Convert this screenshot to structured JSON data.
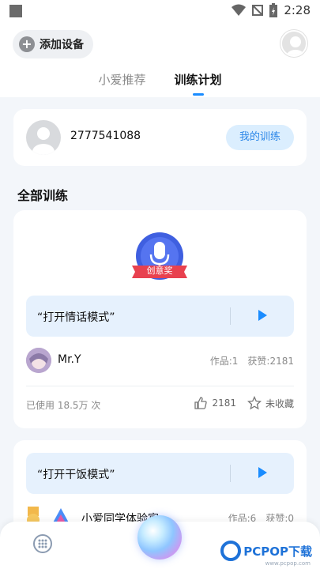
{
  "status_bar": {
    "time": "2:28",
    "icons": [
      "wifi-icon",
      "no-signal-icon",
      "battery-icon"
    ]
  },
  "header": {
    "add_device_label": "添加设备",
    "tabs": [
      {
        "label": "小爱推荐",
        "active": false
      },
      {
        "label": "训练计划",
        "active": true
      }
    ]
  },
  "user_card": {
    "user_id": "2777541088",
    "my_training_label": "我的训练"
  },
  "section_title": "全部训练",
  "trainings": [
    {
      "badge_label": "创意奖",
      "command": "“打开情话模式”",
      "author": "Mr.Y",
      "works": "作品:1",
      "likes_stat": "获赞:2181",
      "usage": "已使用 18.5万 次",
      "like_count": "2181",
      "favorite_label": "未收藏"
    },
    {
      "command": "“打开干饭模式”",
      "author": "小爱同学体验官",
      "works": "作品:6",
      "likes_stat": "获赞:0"
    }
  ],
  "watermark": {
    "brand": "PCPOP下载",
    "sub": "www.pcpop.com"
  },
  "colors": {
    "accent": "#1a8cff",
    "badge_blue": "#3f5fe0",
    "ribbon_red": "#e8414f"
  }
}
